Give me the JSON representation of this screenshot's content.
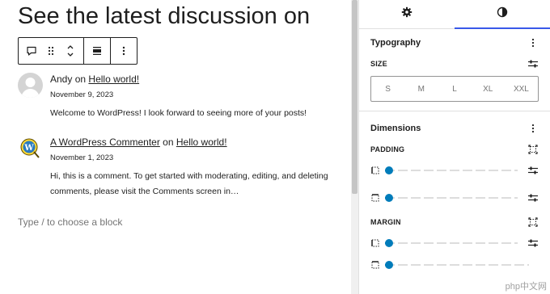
{
  "editor": {
    "heading": "See the latest discussion on",
    "placeholder": "Type / to choose a block"
  },
  "toolbar": {
    "icons": [
      "comments-block-icon",
      "drag-handle-icon",
      "move-up-down-icon",
      "align-icon",
      "more-options-icon"
    ]
  },
  "comments": [
    {
      "author": "Andy",
      "on": "on",
      "post": "Hello world!",
      "date": "November 9, 2023",
      "text": "Welcome to WordPress! I look forward to seeing more of your posts!"
    },
    {
      "author": "A WordPress Commenter",
      "on": "on",
      "post": "Hello world!",
      "date": "November 1, 2023",
      "text": "Hi, this is a comment. To get started with moderating, editing, and deleting comments, please visit the Comments screen in…"
    }
  ],
  "sidebar": {
    "tabs": [
      "settings-tab",
      "styles-tab"
    ],
    "active_tab": "styles-tab",
    "typography": {
      "title": "Typography",
      "size_label": "SIZE",
      "sizes": [
        "S",
        "M",
        "L",
        "XL",
        "XXL"
      ]
    },
    "dimensions": {
      "title": "Dimensions",
      "padding_label": "PADDING",
      "margin_label": "MARGIN",
      "slider_values": [
        0,
        0,
        0,
        0
      ]
    }
  },
  "watermark": "php中文网",
  "colors": {
    "accent": "#3858e9",
    "slider": "#007cba",
    "text": "#1e1e1e",
    "muted": "#757575"
  }
}
